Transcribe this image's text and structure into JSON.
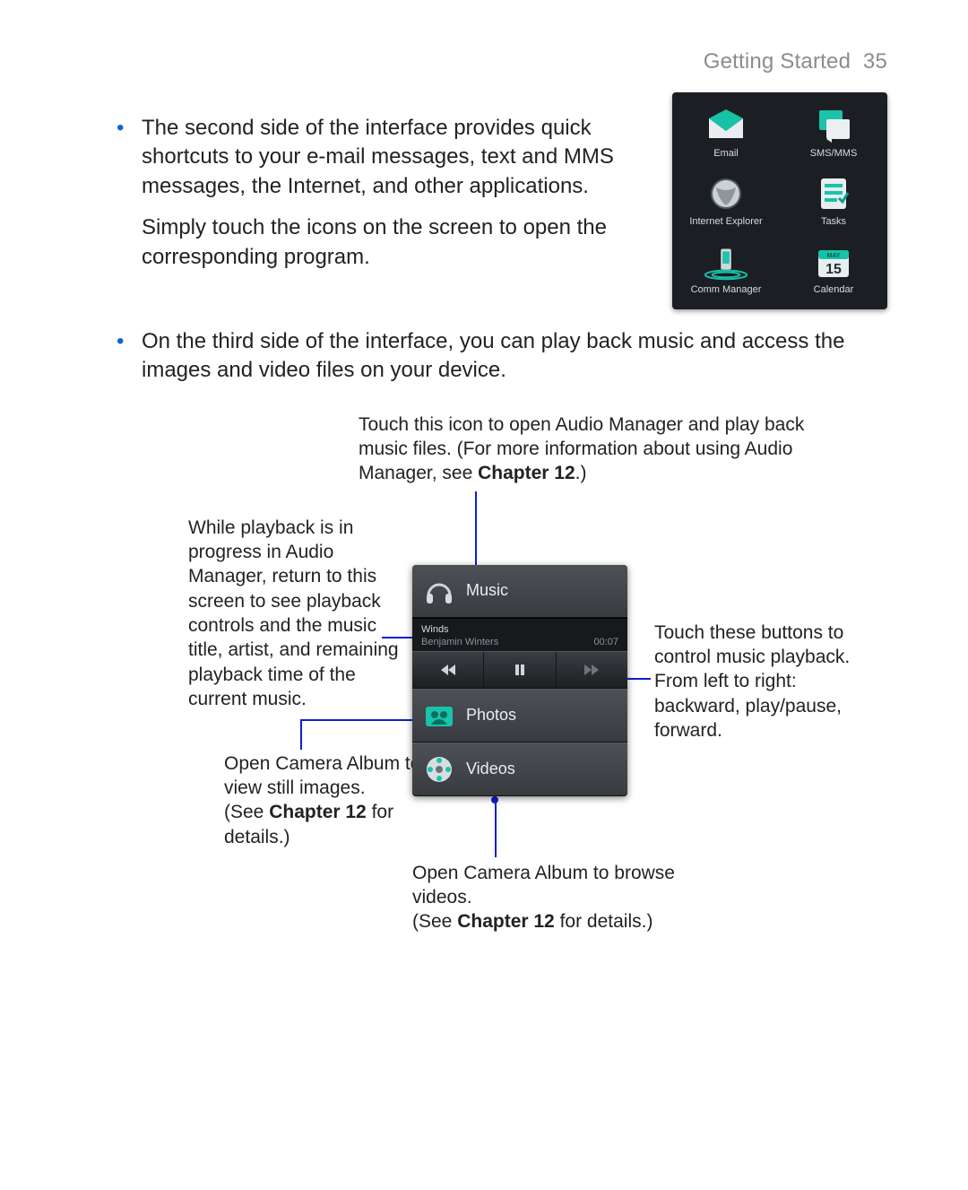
{
  "header": {
    "section": "Getting Started",
    "page": "35"
  },
  "bullets": {
    "b1a": "The second side of the interface provides quick shortcuts to your e-mail messages, text and MMS messages, the Internet, and other applications.",
    "b1b": "Simply touch the icons on the screen to open the corresponding program.",
    "b2": "On the third side of the interface, you can play back music and access the images and video files on your device."
  },
  "shortcuts": [
    {
      "label": "Email"
    },
    {
      "label": "SMS/MMS"
    },
    {
      "label": "Internet Explorer"
    },
    {
      "label": "Tasks"
    },
    {
      "label": "Comm Manager"
    },
    {
      "label": "Calendar"
    }
  ],
  "media": {
    "music_label": "Music",
    "photos_label": "Photos",
    "videos_label": "Videos",
    "track_title": "Winds",
    "track_artist": "Benjamin Winters",
    "track_time": "00:07"
  },
  "callouts": {
    "top": "Touch this icon to open Audio Manager and play back music files. (For more information about using Audio Manager, see ",
    "top_bold": "Chapter 12",
    "top_tail": ".)",
    "left": "While playback is in progress in Audio Manager, return to this screen to see playback controls and the music title, artist, and remaining playback time of the current music.",
    "right1": "Touch these buttons to control music playback.",
    "right2": "From left to right: backward, play/pause, forward.",
    "photos1": "Open Camera Album to view still images.",
    "photos2a": "(See ",
    "photos2b": "Chapter 12",
    "photos2c": " for details.)",
    "videos1": "Open Camera Album to browse videos.",
    "videos2a": "(See ",
    "videos2b": "Chapter 12",
    "videos2c": " for details.)"
  },
  "calendar_day": "15",
  "calendar_month": "MAY"
}
